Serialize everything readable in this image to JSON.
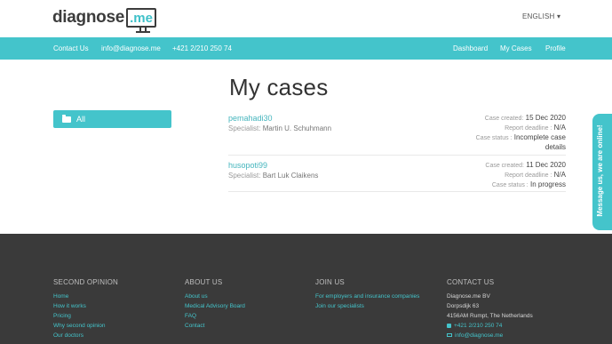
{
  "header": {
    "logo_text": "diagnose",
    "logo_suffix": ".me",
    "language": "ENGLISH ▾"
  },
  "nav": {
    "contact_us": "Contact Us",
    "email": "info@diagnose.me",
    "phone": "+421 2/210 250 74",
    "dashboard": "Dashboard",
    "my_cases": "My Cases",
    "profile": "Profile"
  },
  "main": {
    "title": "My cases",
    "filter_label": "All",
    "cases": [
      {
        "user": "pemahadi30",
        "specialist_label": "Specialist:",
        "specialist": "Martin U. Schuhmann",
        "created_label": "Case created:",
        "created": "15 Dec 2020",
        "deadline_label": "Report deadline :",
        "deadline": "N/A",
        "status_label": "Case status :",
        "status_line1": "Incomplete case",
        "status_line2": "details"
      },
      {
        "user": "husopoti99",
        "specialist_label": "Specialist:",
        "specialist": "Bart Luk Claikens",
        "created_label": "Case created:",
        "created": "11 Dec 2020",
        "deadline_label": "Report deadline :",
        "deadline": "N/A",
        "status_label": "Case status :",
        "status_line1": "In progress",
        "status_line2": ""
      }
    ]
  },
  "side_tab": {
    "label": "Message us, we are online!"
  },
  "footer": {
    "second_opinion": {
      "title": "SECOND OPINION",
      "links": [
        "Home",
        "How it works",
        "Pricing",
        "Why second opinion",
        "Our doctors"
      ]
    },
    "about_us": {
      "title": "ABOUT US",
      "links": [
        "About us",
        "Medical Advisory Board",
        "FAQ",
        "Contact"
      ]
    },
    "join_us": {
      "title": "JOIN US",
      "links": [
        "For employers and insurance companies",
        "Join our specialists"
      ]
    },
    "contact_us": {
      "title": "CONTACT US",
      "company": "Diagnose.me BV",
      "street": "Dorpsdijk 63",
      "city": "4156AM Rumpt, The Netherlands",
      "phone": "+421 2/210 250 74",
      "email": "info@diagnose.me"
    }
  },
  "colors": {
    "accent": "#44c4cb",
    "footer_bg": "#3a3a3a"
  }
}
